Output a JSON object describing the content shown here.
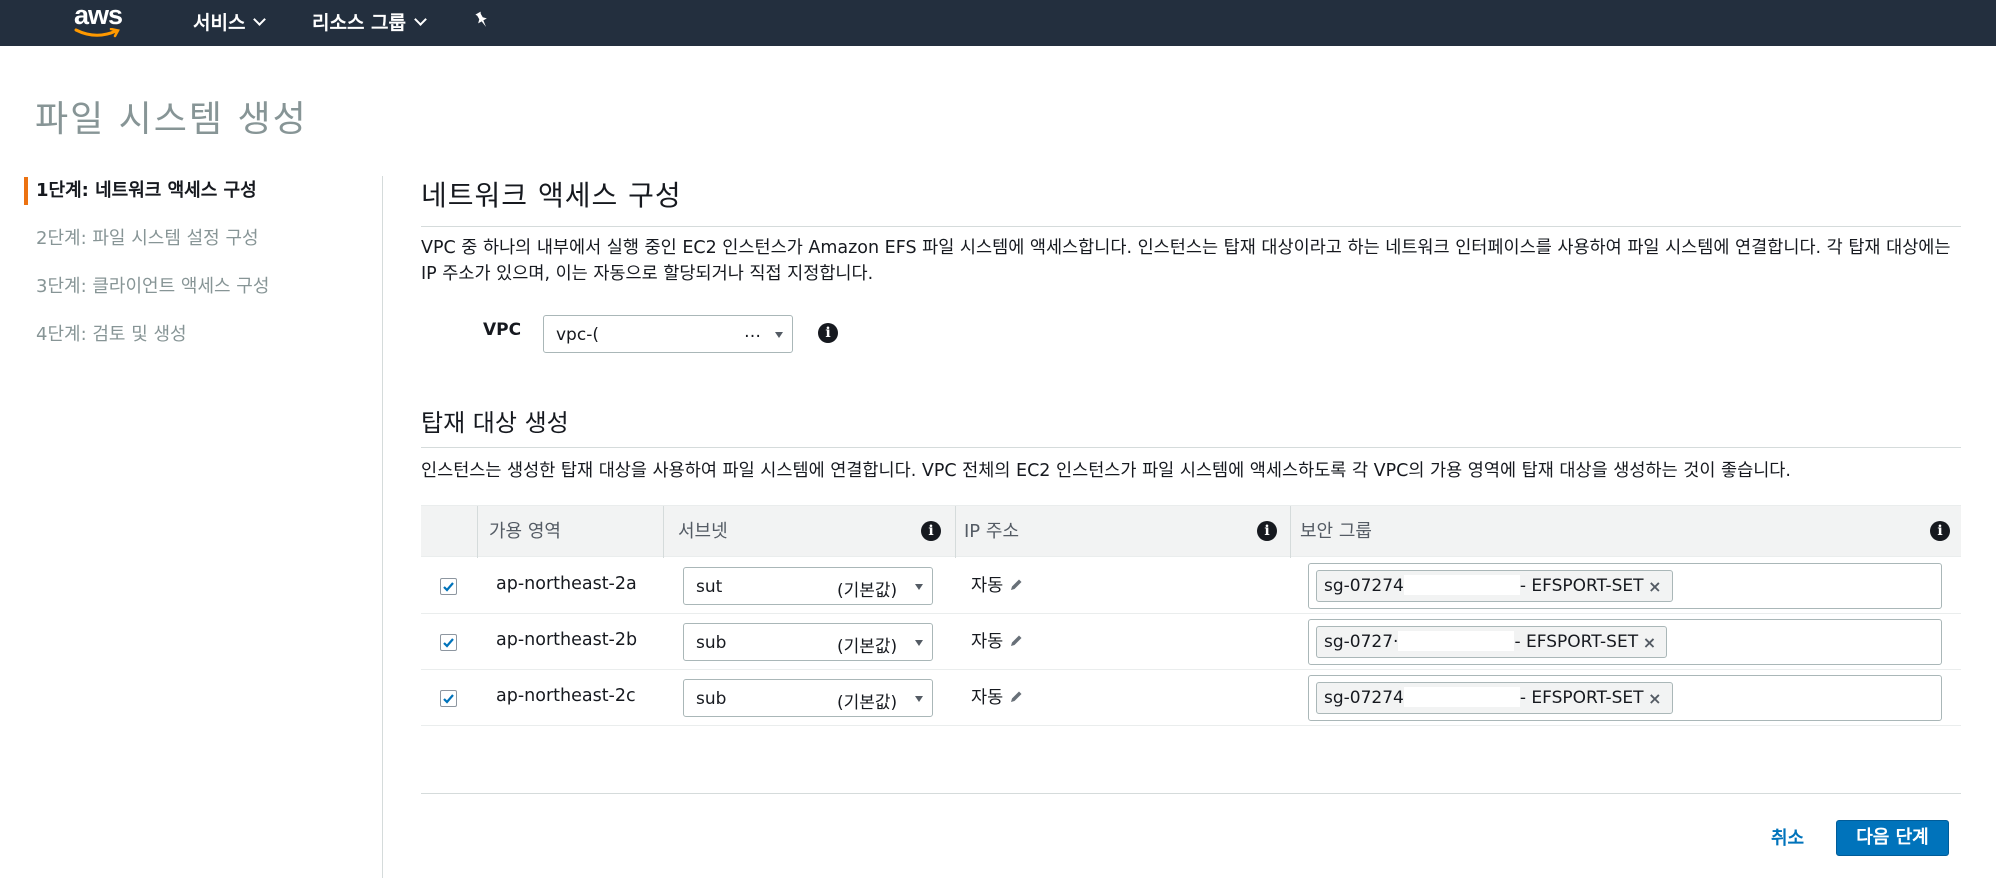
{
  "nav": {
    "logo_text": "aws",
    "services_label": "서비스",
    "resource_groups_label": "리소스 그룹",
    "pin_icon": "pin-icon"
  },
  "page": {
    "title": "파일 시스템 생성"
  },
  "steps": [
    {
      "label": "1단계: 네트워크 액세스 구성",
      "active": true
    },
    {
      "label": "2단계: 파일 시스템 설정 구성",
      "active": false
    },
    {
      "label": "3단계: 클라이언트 액세스 구성",
      "active": false
    },
    {
      "label": "4단계: 검토 및 생성",
      "active": false
    }
  ],
  "section1": {
    "title": "네트워크 액세스 구성",
    "description": "VPC 중 하나의 내부에서 실행 중인 EC2 인스턴스가 Amazon EFS 파일 시스템에 액세스합니다. 인스턴스는 탑재 대상이라고 하는 네트워크 인터페이스를 사용하여 파일 시스템에 연결합니다. 각 탑재 대상에는 IP 주소가 있으며, 이는 자동으로 할당되거나 직접 지정합니다.",
    "vpc_label": "VPC",
    "vpc_value": "vpc-(",
    "vpc_ellipsis": "…"
  },
  "section2": {
    "title": "탑재 대상 생성",
    "description": "인스턴스는 생성한 탑재 대상을 사용하여 파일 시스템에 연결합니다. VPC 전체의 EC2 인스턴스가 파일 시스템에 액세스하도록 각 VPC의 가용 영역에 탑재 대상을 생성하는 것이 좋습니다."
  },
  "table": {
    "headers": {
      "az": "가용 영역",
      "subnet": "서브넷",
      "ip": "IP 주소",
      "sg": "보안 그룹"
    },
    "rows": [
      {
        "checked": true,
        "az": "ap-northeast-2a",
        "subnet": "sut",
        "subnet_default": "(기본값)",
        "ip": "자동",
        "sg_prefix": "sg-07274",
        "sg_suffix": "- EFSPORT-SET"
      },
      {
        "checked": true,
        "az": "ap-northeast-2b",
        "subnet": "sub",
        "subnet_default": "(기본값)",
        "ip": "자동",
        "sg_prefix": "sg-0727·",
        "sg_suffix": "- EFSPORT-SET"
      },
      {
        "checked": true,
        "az": "ap-northeast-2c",
        "subnet": "sub",
        "subnet_default": "(기본값)",
        "ip": "자동",
        "sg_prefix": "sg-07274",
        "sg_suffix": "- EFSPORT-SET"
      }
    ]
  },
  "footer": {
    "cancel_label": "취소",
    "next_label": "다음 단계"
  },
  "colors": {
    "nav_bg": "#232f3e",
    "accent_orange": "#ec7211",
    "primary_blue": "#0073bb"
  }
}
